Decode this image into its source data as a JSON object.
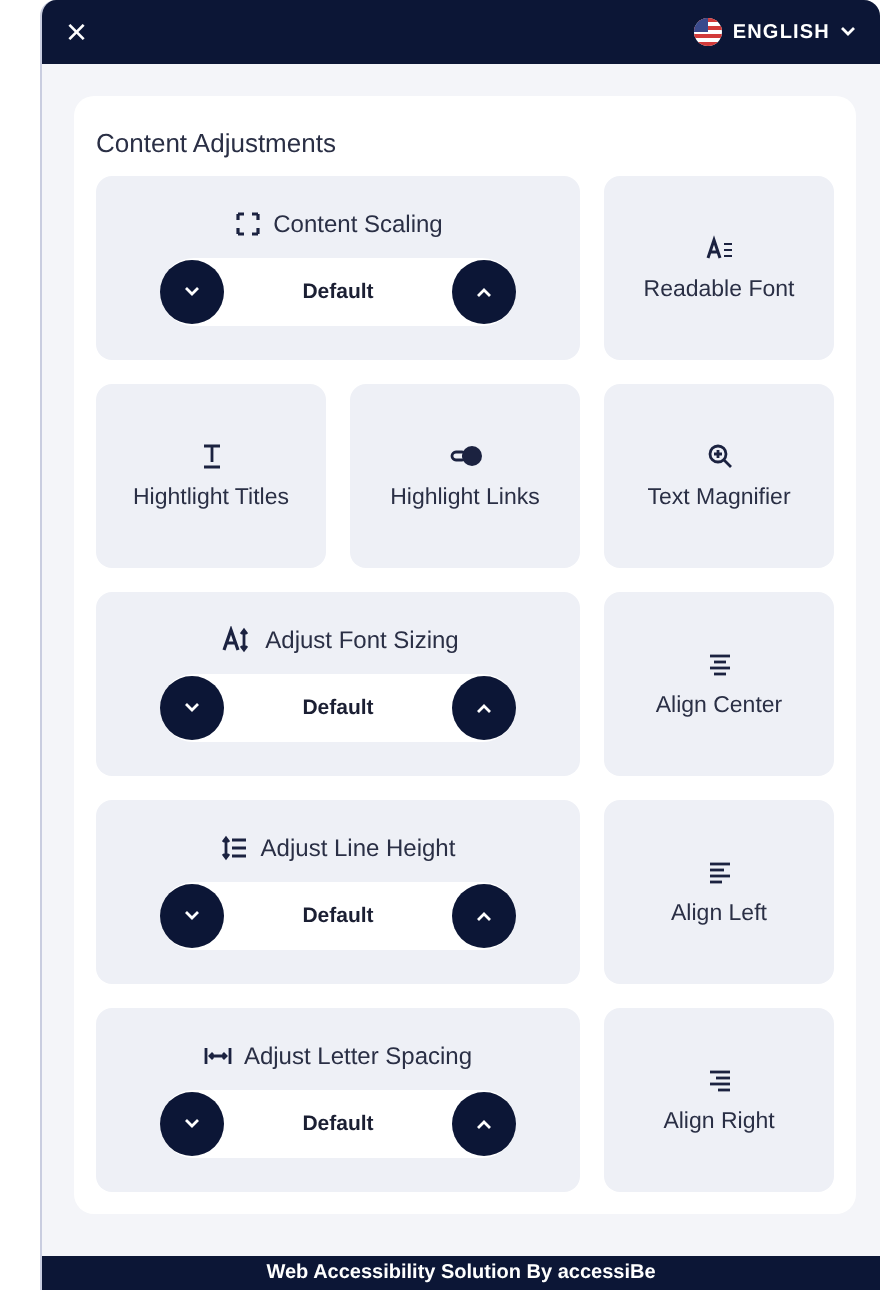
{
  "header": {
    "close": "×",
    "language": "ENGLISH"
  },
  "section": {
    "title": "Content Adjustments",
    "tiles": [
      {
        "kind": "stepper",
        "label": "Content Scaling",
        "value": "Default"
      },
      {
        "kind": "toggle",
        "label": "Readable Font"
      },
      {
        "kind": "toggle",
        "label": "Hightlight Titles"
      },
      {
        "kind": "toggle",
        "label": "Highlight Links"
      },
      {
        "kind": "toggle",
        "label": "Text Magnifier"
      },
      {
        "kind": "stepper",
        "label": "Adjust Font Sizing",
        "value": "Default"
      },
      {
        "kind": "toggle",
        "label": "Align Center"
      },
      {
        "kind": "stepper",
        "label": "Adjust Line Height",
        "value": "Default"
      },
      {
        "kind": "toggle",
        "label": "Align Left"
      },
      {
        "kind": "stepper",
        "label": "Adjust Letter Spacing",
        "value": "Default"
      },
      {
        "kind": "toggle",
        "label": "Align Right"
      }
    ]
  },
  "footer": "Web Accessibility Solution By accessiBe"
}
